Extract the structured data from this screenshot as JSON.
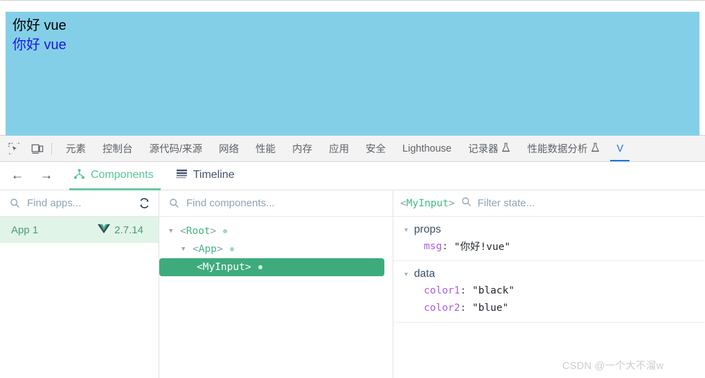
{
  "page": {
    "background_color": "#84cfe8",
    "lines": [
      {
        "text": "你好 vue",
        "color": "#000000",
        "color_name": "black"
      },
      {
        "text": "你好 vue",
        "color": "#1818e0",
        "color_name": "blue"
      }
    ]
  },
  "devtools": {
    "accent_color": "#1a73e8",
    "icons": {
      "inspect": "inspect-element-icon",
      "device": "device-toolbar-icon"
    },
    "tabs": [
      {
        "label": "元素",
        "active": false,
        "flask": false
      },
      {
        "label": "控制台",
        "active": false,
        "flask": false
      },
      {
        "label": "源代码/来源",
        "active": false,
        "flask": false
      },
      {
        "label": "网络",
        "active": false,
        "flask": false
      },
      {
        "label": "性能",
        "active": false,
        "flask": false
      },
      {
        "label": "内存",
        "active": false,
        "flask": false
      },
      {
        "label": "应用",
        "active": false,
        "flask": false
      },
      {
        "label": "安全",
        "active": false,
        "flask": false
      },
      {
        "label": "Lighthouse",
        "active": false,
        "flask": false
      },
      {
        "label": "记录器",
        "active": false,
        "flask": true
      },
      {
        "label": "性能数据分析",
        "active": false,
        "flask": true
      },
      {
        "label": "V",
        "active": true,
        "flask": false
      }
    ]
  },
  "vue_devtools": {
    "accent_color": "#42b983",
    "nav": {
      "back": "←",
      "forward": "→"
    },
    "tabs": [
      {
        "label": "Components",
        "icon": "component-tree-icon",
        "active": true
      },
      {
        "label": "Timeline",
        "icon": "timeline-icon",
        "active": false
      }
    ],
    "apps_pane": {
      "search_placeholder": "Find apps...",
      "refresh_icon": "refresh-icon",
      "apps": [
        {
          "name": "App 1",
          "version": "2.7.14",
          "selected": true
        }
      ]
    },
    "components_pane": {
      "search_placeholder": "Find components...",
      "tree": [
        {
          "label": "<Root>",
          "name": "Root",
          "depth": 1,
          "caret": "▼",
          "has_dot": true,
          "selected": false
        },
        {
          "label": "<App>",
          "name": "App",
          "depth": 2,
          "caret": "▼",
          "has_dot": true,
          "selected": false
        },
        {
          "label": "<MyInput>",
          "name": "MyInput",
          "depth": 3,
          "caret": "",
          "has_dot": true,
          "selected": true
        }
      ]
    },
    "state_pane": {
      "component": "<MyInput>",
      "component_name": "MyInput",
      "filter_placeholder": "Filter state...",
      "groups": [
        {
          "title": "props",
          "caret": "▼",
          "entries": [
            {
              "key": "msg",
              "value": "\"你好!vue\""
            }
          ]
        },
        {
          "title": "data",
          "caret": "▼",
          "entries": [
            {
              "key": "color1",
              "value": "\"black\""
            },
            {
              "key": "color2",
              "value": "\"blue\""
            }
          ]
        }
      ]
    }
  },
  "watermark": {
    "text": "CSDN @一个大不溜w"
  }
}
